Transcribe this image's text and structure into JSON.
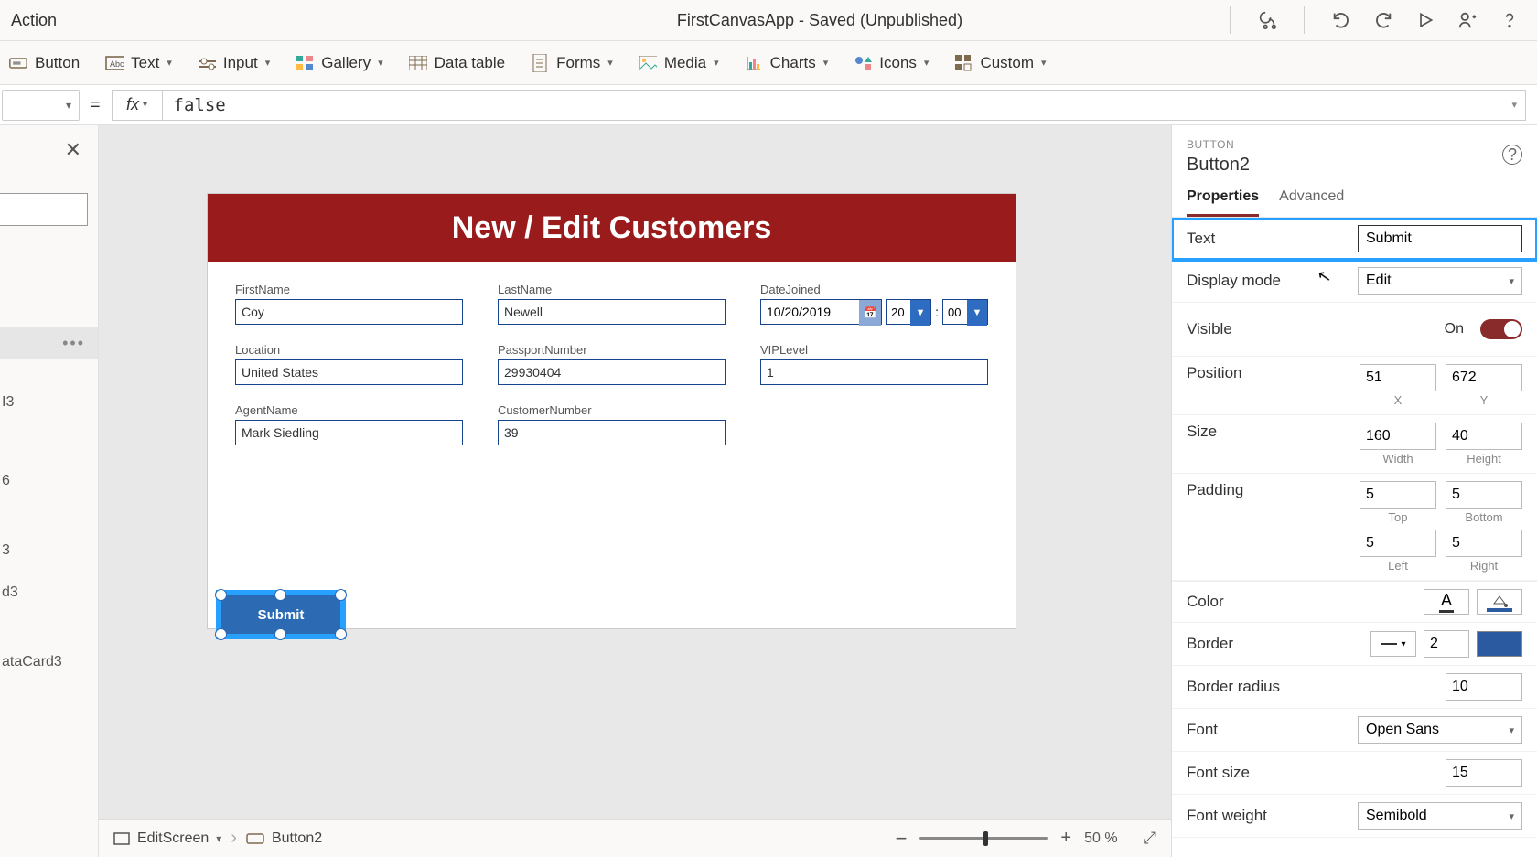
{
  "header": {
    "menu_action": "Action",
    "app_title": "FirstCanvasApp - Saved (Unpublished)"
  },
  "ribbon": {
    "button": "Button",
    "text": "Text",
    "input": "Input",
    "gallery": "Gallery",
    "data_table": "Data table",
    "forms": "Forms",
    "media": "Media",
    "charts": "Charts",
    "icons": "Icons",
    "custom": "Custom"
  },
  "formula": {
    "equals": "=",
    "fx": "fx",
    "value": "false"
  },
  "left_panel": {
    "items": [
      "I3",
      "6",
      "3",
      "d3",
      "ataCard3"
    ]
  },
  "canvas": {
    "title": "New / Edit Customers",
    "fields": {
      "first_name": {
        "label": "FirstName",
        "value": "Coy"
      },
      "last_name": {
        "label": "LastName",
        "value": "Newell"
      },
      "date_joined": {
        "label": "DateJoined",
        "value": "10/20/2019",
        "hour": "20",
        "minute": "00"
      },
      "location": {
        "label": "Location",
        "value": "United States"
      },
      "passport": {
        "label": "PassportNumber",
        "value": "29930404"
      },
      "vip": {
        "label": "VIPLevel",
        "value": "1"
      },
      "agent": {
        "label": "AgentName",
        "value": "Mark Siedling"
      },
      "customer_no": {
        "label": "CustomerNumber",
        "value": "39"
      }
    },
    "submit": "Submit"
  },
  "statusbar": {
    "screen": "EditScreen",
    "element": "Button2",
    "zoom": "50",
    "zoom_pct": "%"
  },
  "props": {
    "type": "BUTTON",
    "name": "Button2",
    "tab_properties": "Properties",
    "tab_advanced": "Advanced",
    "text": {
      "label": "Text",
      "value": "Submit"
    },
    "display_mode": {
      "label": "Display mode",
      "value": "Edit"
    },
    "visible": {
      "label": "Visible",
      "state": "On"
    },
    "position": {
      "label": "Position",
      "x": "51",
      "y": "672",
      "xl": "X",
      "yl": "Y"
    },
    "size": {
      "label": "Size",
      "w": "160",
      "h": "40",
      "wl": "Width",
      "hl": "Height"
    },
    "padding": {
      "label": "Padding",
      "top": "5",
      "right": "5",
      "left": "5",
      "bottom": "5",
      "tl": "Top",
      "rl": "Right",
      "ll": "Left",
      "bl": "Bottom"
    },
    "color": {
      "label": "Color",
      "a": "A"
    },
    "border": {
      "label": "Border",
      "width": "2"
    },
    "border_radius": {
      "label": "Border radius",
      "value": "10"
    },
    "font": {
      "label": "Font",
      "value": "Open Sans"
    },
    "font_size": {
      "label": "Font size",
      "value": "15"
    },
    "font_weight": {
      "label": "Font weight",
      "value": "Semibold"
    }
  }
}
